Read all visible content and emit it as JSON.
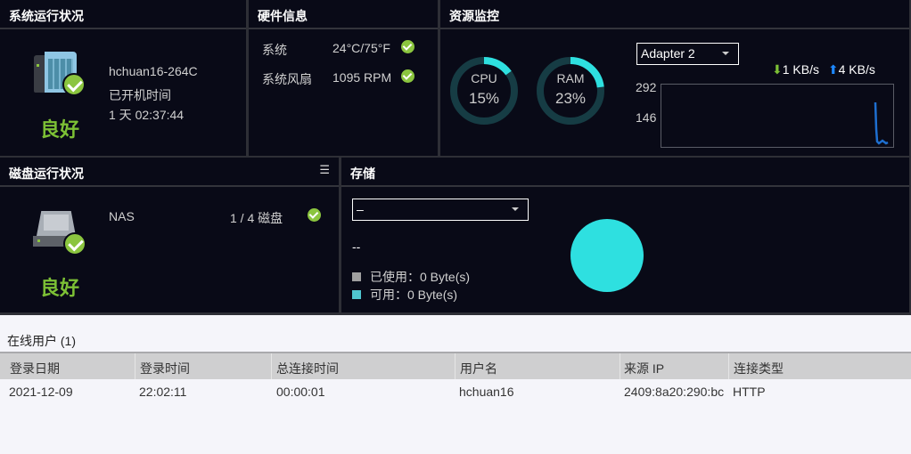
{
  "system_status": {
    "title": "系统运行状况",
    "hostname": "hchuan16-264C",
    "uptime_label": "已开机时间",
    "uptime": "1 天 02:37:44",
    "status": "良好"
  },
  "hardware": {
    "title": "硬件信息",
    "rows": [
      {
        "label": "系统",
        "value": "24°C/75°F"
      },
      {
        "label": "系统风扇",
        "value": "1095 RPM"
      }
    ]
  },
  "resource": {
    "title": "资源监控",
    "cpu": {
      "label": "CPU",
      "value": "15%",
      "percent": 15
    },
    "ram": {
      "label": "RAM",
      "value": "23%",
      "percent": 23
    },
    "adapter": "Adapter 2",
    "download": "1 KB/s",
    "upload": "4 KB/s",
    "y_ticks": [
      "292",
      "146"
    ],
    "accent": "#2ee0e0"
  },
  "disk": {
    "title": "磁盘运行状况",
    "name": "NAS",
    "count": "1 / 4 磁盘",
    "status": "良好"
  },
  "storage": {
    "title": "存储",
    "select": "–",
    "volume": "--",
    "used": "已使用：0 Byte(s)",
    "free": "可用：0 Byte(s)"
  },
  "online_users": {
    "title": "在线用户 (1)",
    "columns": [
      "登录日期",
      "登录时间",
      "总连接时间",
      "用户名",
      "来源 IP",
      "连接类型"
    ],
    "rows": [
      [
        "2021-12-09",
        "22:02:11",
        "00:00:01",
        "hchuan16",
        "2409:8a20:290:bc",
        "HTTP"
      ]
    ]
  }
}
